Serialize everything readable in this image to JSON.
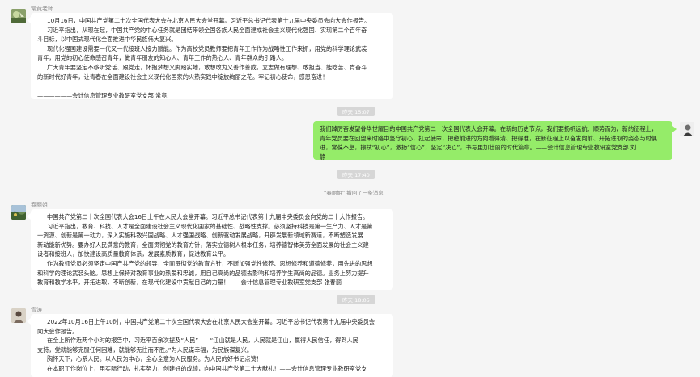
{
  "colors": {
    "bubble_self": "#95ec69",
    "bubble_other": "#ffffff",
    "background": "#f5f5f5"
  },
  "msg1": {
    "sender": "常竟老师",
    "lines": [
      "10月16日，中国共产党第二十次全国代表大会在北京人民大会堂开幕。习近平总书记代表第十九届中央委员会向大会作报告。",
      "习近平指出，从现在起，中国共产党的中心任务就是团结带领全国各族人民全面建成社会主义现代化强国、实现第二个百年奋",
      "斗目标，以中国式现代化全面推进中华民族伟大复兴。",
      "现代化强国建设需要一代又一代接班人接力赋能。作为高校党员教师要把青年工作作为战略性工作来抓，用党的科学理论武装",
      "青年，用党的初心使命感召青年，做青年朋友的知心人、青年工作的热心人、青年群众的引路人。",
      "广大青年要坚定不移听党话、跟党走，怀抱梦想又脚踏实地，敢想敢为又善作善成，立志做有理想、敢担当、能吃苦、肯奋斗",
      "的新时代好青年，让青春在全面建设社会主义现代化国家的火热实践中绽放绚丽之花。牢记初心使命，感恩奋进！",
      "",
      "——————会计信息管理专业教研室党支部 常竟"
    ]
  },
  "ts1": "昨天 15:07",
  "msg2": {
    "lines": [
      "我们踔厉奋发望眷华世耀目的中国共产党第二十次全国代表大会开幕。在新的历史节点，我们要扬帆远航、顺势而为，新的征程上，",
      "青年党员要在回望来时路中坚守初心，扛起使命，把稳前进的方向看得清、把得准，在新征程上以奋发向前、开拓进取的姿态与时俱",
      "进，常葆不怠，擦拭“初心”，激扬“信心”，坚定“决心”，书写更加壮丽的时代篇章。——会计信息管理专业教研室党支部 刘",
      "静"
    ]
  },
  "ts2": "昨天 17:40",
  "sys_msg": "“春丽姐” 撤回了一条消息",
  "msg3": {
    "sender": "春丽姐",
    "lines": [
      "中国共产党第二十次全国代表大会16日上午在人民大会堂开幕。习近平总书记代表第十九届中央委员会向党的二十大作报告。",
      "习近平指出，教育、科技、人才是全面建设社会主义现代化国家的基础性、战略性支撑。必须坚持科技是第一生产力、人才是第",
      "一资源、创新是第一动力，深入实施科教兴国战略、人才强国战略、创新驱动发展战略，开辟发展新领域新赛道，不断塑造发展",
      "新动能新优势。要办好人民满意的教育，全面贯彻党的教育方针，落实立德树人根本任务，培养德智体美劳全面发展的社会主义建",
      "设者和接班人，加快建设高质量教育体系，发展素质教育，促进教育公平。",
      "作为教师党员必须坚定中国产共产党的领导，全面贯彻党的教育方针，不断加强党性修养、思想修养和道德修养，用先进的思想",
      "和科学的理论武装头脑。思想上保持对教育事业的热爱和忠诚，用自己高尚的品德去影响和培养学生高尚的品德。业务上努力提升",
      "教育和教学水平，开拓进取，不断创新，在现代化建设中贡献自己的力量！——会计信息管理专业教研室党支部 张春丽"
    ]
  },
  "ts3": "昨天 18:05",
  "msg4": {
    "sender": "雪涛",
    "lines": [
      "2022年10月16日上午10时，中国共产党第二十次全国代表大会在北京人民大会堂开幕。习近平总书记代表第十九届中央委员会",
      "向大会作报告。",
      "在全上所作近两个小时的报告中，习近平百余次提及“人民”——“江山就是人民，人民就是江山，赢得人民信任，得到人民",
      "支持，党就能够克服任何困难，就能够无往而不胜。”为人民谋幸福，为民族谋复兴。",
      "胸怀天下，心系人民。以人民为中心，全心全意为人民服务。为人民的好书记点赞！",
      "在本职工作岗位上，用实际行动，扎实努力，创建好的成绩，向中国共产党第二十大献礼！——会计信息管理专业教研室党支"
    ]
  }
}
